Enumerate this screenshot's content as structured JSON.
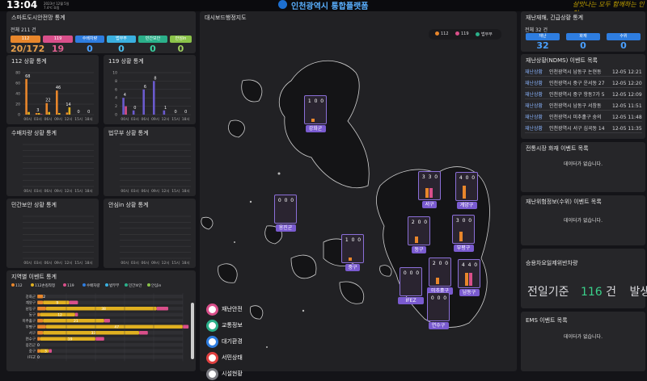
{
  "topbar": {
    "time": "13:04",
    "date_line1": "2023년 12월 5일",
    "date_line2": "7.4℃ 흐림",
    "title": "인천광역시 통합플랫폼",
    "slogan": "살맛나는 모두 함께하는 인천"
  },
  "smart": {
    "title": "스마트도시안전망 통계",
    "total": "전체 211 건",
    "cards": [
      {
        "label": "112",
        "value": "20/172",
        "color": "#e8862b",
        "vcolor": "#e8a04b"
      },
      {
        "label": "119",
        "value": "19",
        "color": "#d94f8a",
        "vcolor": "#e06090"
      },
      {
        "label": "수배차량",
        "value": "0",
        "color": "#2e7de0",
        "vcolor": "#4aa0ff"
      },
      {
        "label": "법무부",
        "value": "0",
        "color": "#3ab0e0",
        "vcolor": "#4ac0f0"
      },
      {
        "label": "민간보안",
        "value": "0",
        "color": "#2bb08a",
        "vcolor": "#3ad0a0"
      },
      {
        "label": "안심in",
        "value": "0",
        "color": "#8bc34a",
        "vcolor": "#a0d060"
      }
    ]
  },
  "stats112": {
    "title": "112 상황 통계",
    "yticks": [
      "80",
      "60",
      "40",
      "20",
      "0"
    ],
    "xticks": [
      "00시",
      "03시",
      "06시",
      "09시",
      "12시",
      "15시",
      "18시"
    ],
    "series": [
      {
        "name": "112",
        "color": "#e8862b",
        "values": [
          68,
          3,
          22,
          46,
          4,
          0,
          0
        ]
      },
      {
        "name": "112손킬",
        "color": "#e0b020",
        "values": [
          5,
          3,
          5,
          3,
          14,
          0,
          0
        ]
      },
      {
        "name": "119",
        "color": "#d94f8a",
        "values": [
          0,
          1,
          0,
          0,
          0,
          0,
          0
        ]
      }
    ],
    "labels": [
      "68",
      "3",
      "22",
      "46",
      "14",
      "0",
      "0"
    ]
  },
  "stats119": {
    "title": "119 상황 통계",
    "yticks": [
      "10",
      "8",
      "6",
      "4",
      "2",
      "0"
    ],
    "xticks": [
      "00시",
      "03시",
      "06시",
      "09시",
      "12시",
      "15시",
      "18시"
    ],
    "series": [
      {
        "name": "119",
        "color": "#6a5acd",
        "values": [
          4,
          1,
          6,
          8,
          1,
          0,
          0
        ]
      },
      {
        "name": "법무부",
        "color": "#d94f8a",
        "values": [
          2,
          0,
          0,
          0,
          0,
          0,
          0
        ]
      }
    ],
    "labels": [
      "4",
      "0",
      "6",
      "8",
      "1",
      "0",
      "0"
    ]
  },
  "wanted": {
    "title": "수배차량 상황 통계",
    "xticks": [
      "00시",
      "03시",
      "06시",
      "09시",
      "12시",
      "15시",
      "18시"
    ]
  },
  "justice": {
    "title": "법무부 상황 통계",
    "xticks": [
      "00시",
      "03시",
      "06시",
      "09시",
      "12시",
      "15시",
      "18시"
    ]
  },
  "private": {
    "title": "민간보안 상황 통계",
    "xticks": [
      "00시",
      "03시",
      "06시",
      "09시",
      "12시",
      "15시",
      "18시"
    ]
  },
  "safein": {
    "title": "안심in 상황 통계",
    "xticks": [
      "00시",
      "03시",
      "06시",
      "09시",
      "12시",
      "15시",
      "18시"
    ]
  },
  "regional": {
    "title": "지역별 이벤트 통계",
    "legend": [
      {
        "name": "112",
        "color": "#e8862b"
      },
      {
        "name": "112손킬착정",
        "color": "#e0b020"
      },
      {
        "name": "119",
        "color": "#d94f8a"
      },
      {
        "name": "수배차량",
        "color": "#2e7de0"
      },
      {
        "name": "법무부",
        "color": "#3ab0e0"
      },
      {
        "name": "민간보안",
        "color": "#2bb08a"
      },
      {
        "name": "안심in",
        "color": "#8bc34a"
      }
    ],
    "rows": [
      {
        "name": "강화군",
        "a": 2,
        "b": 0,
        "c": 0
      },
      {
        "name": "계양구",
        "a": 2,
        "b": 9,
        "c": 3
      },
      {
        "name": "남동구",
        "a": 3,
        "b": 38,
        "c": 4
      },
      {
        "name": "동구",
        "a": 1,
        "b": 12,
        "c": 1
      },
      {
        "name": "미추홀구",
        "a": 2,
        "b": 21,
        "c": 2
      },
      {
        "name": "부평구",
        "a": 3,
        "b": 47,
        "c": 2
      },
      {
        "name": "서구",
        "a": 2,
        "b": 33,
        "c": 3
      },
      {
        "name": "연수구",
        "a": 1,
        "b": 19,
        "c": 3
      },
      {
        "name": "옹진군",
        "a": 0,
        "b": 0,
        "c": 0
      },
      {
        "name": "중구",
        "a": 1,
        "b": 3,
        "c": 1
      },
      {
        "name": "IFEZ",
        "a": 0,
        "b": 0,
        "c": 0
      }
    ],
    "labels": [
      "2",
      "9",
      "38",
      "12",
      "21",
      "47",
      "33",
      "19",
      "0",
      "3",
      "0"
    ]
  },
  "map": {
    "title": "대시보드행정지도",
    "legend": [
      {
        "name": "112",
        "color": "#e8862b"
      },
      {
        "name": "119",
        "color": "#d94f8a"
      },
      {
        "name": "법무부",
        "color": "#2bb08a"
      }
    ],
    "districts": [
      {
        "name": "강화군",
        "nums": "1 0 0"
      },
      {
        "name": "옹진군",
        "nums": "0 0 0"
      },
      {
        "name": "중구",
        "nums": "1 0 0"
      },
      {
        "name": "동구",
        "nums": "2 0 0"
      },
      {
        "name": "서구",
        "nums": "3 3 0"
      },
      {
        "name": "계양구",
        "nums": "4 0 0"
      },
      {
        "name": "부평구",
        "nums": "3 0 0"
      },
      {
        "name": "미추홀구",
        "nums": "2 0 0"
      },
      {
        "name": "남동구",
        "nums": "4 4 0"
      },
      {
        "name": "IFEZ",
        "nums": "0 0 0"
      },
      {
        "name": "연수구",
        "nums": "0 0 0"
      }
    ],
    "categories": [
      {
        "label": "재난안전",
        "color": "#d94f8a",
        "icon": "alert-icon"
      },
      {
        "label": "교통정보",
        "color": "#2bb08a",
        "icon": "car-icon"
      },
      {
        "label": "대기환경",
        "color": "#2e7de0",
        "icon": "cloud-icon"
      },
      {
        "label": "서민상태",
        "color": "#e04040",
        "icon": "heart-icon"
      },
      {
        "label": "시설현황",
        "color": "#7a7a80",
        "icon": "building-icon"
      }
    ]
  },
  "disaster": {
    "title": "재난재해, 긴급상황 통계",
    "total": "전체 32 건",
    "cards": [
      {
        "label": "재난",
        "value": "32",
        "color": "#2e7de0"
      },
      {
        "label": "화재",
        "value": "0",
        "color": "#2e7de0"
      },
      {
        "label": "수위",
        "value": "0",
        "color": "#2e7de0"
      }
    ]
  },
  "ndms": {
    "title": "재난상황(NDMS) 이벤트 목록",
    "rows": [
      {
        "tag": "재난상황",
        "text": "인천광역시 남동구 논현동",
        "time": "12-05 12:21"
      },
      {
        "tag": "재난상황",
        "text": "인천광역시 중구 운서동 27",
        "time": "12-05 12:20"
      },
      {
        "tag": "재난상황",
        "text": "인천광역시 중구 항동7가 5",
        "time": "12-05 12:09"
      },
      {
        "tag": "재난상황",
        "text": "인천광역시 남동구 서창동",
        "time": "12-05 11:51"
      },
      {
        "tag": "재난상황",
        "text": "인천광역시 미추홀구 숭의",
        "time": "12-05 11:48"
      },
      {
        "tag": "재난상황",
        "text": "인천광역시 서구 심곡동 14",
        "time": "12-05 11:35"
      }
    ]
  },
  "market": {
    "title": "전통시장 화재 이벤트 목록",
    "empty": "데이터가 없습니다."
  },
  "river": {
    "title": "재난위험정보(수위) 이벤트 목록",
    "empty": "데이터가 없습니다."
  },
  "care": {
    "title": "승용차요일제위반차량",
    "label1": "전일기준",
    "value": "116",
    "unit": "건",
    "label2": "발생"
  },
  "ems": {
    "title": "EMS 이벤트 목록",
    "empty": "데이터가 없습니다."
  }
}
